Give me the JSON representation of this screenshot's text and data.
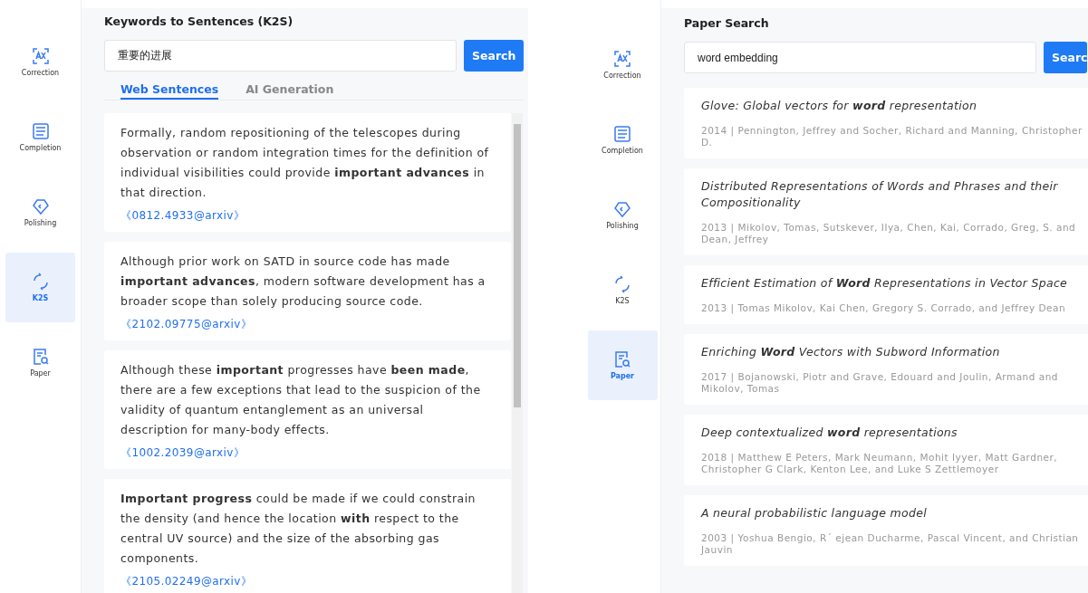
{
  "panels": [
    {
      "kind": "k2s",
      "sidebar": [
        {
          "kind": "correction",
          "label": "Correction",
          "selected": false
        },
        {
          "kind": "completion",
          "label": "Completion",
          "selected": false
        },
        {
          "kind": "polishing",
          "label": "Polishing",
          "selected": false
        },
        {
          "kind": "k2s",
          "label": "K2S",
          "selected": true
        },
        {
          "kind": "paper",
          "label": "Paper",
          "selected": false
        }
      ],
      "title": "Keywords to Sentences (K2S)",
      "search": {
        "value": "重要的进展",
        "button": "Search"
      },
      "tabs": [
        {
          "label": "Web Sentences",
          "selected": true
        },
        {
          "label": "AI Generation",
          "selected": false
        }
      ],
      "results": [
        {
          "text": "Formally, random repositioning of the telescopes during observation or random integration times for the definition of individual visibilities could provide **important advances** in that direction.",
          "source": "《0812.4933@arxiv》"
        },
        {
          "text": "Although prior work on SATD in source code has made **important advances**, modern software development has a broader scope than solely producing source code.",
          "source": "《2102.09775@arxiv》"
        },
        {
          "text": "Although these **important** progresses have **been made**, there are a few exceptions that lead to the suspicion of the validity of quantum entanglement as an universal description for many-body effects.",
          "source": "《1002.2039@arxiv》"
        },
        {
          "text": "**Important progress** could be made if we could constrain the density (and hence the location **with** respect to the central UV source) and the size of the absorbing gas components.",
          "source": "《2105.02249@arxiv》"
        }
      ]
    },
    {
      "kind": "paper",
      "sidebar": [
        {
          "kind": "correction",
          "label": "Correction",
          "selected": false
        },
        {
          "kind": "completion",
          "label": "Completion",
          "selected": false
        },
        {
          "kind": "polishing",
          "label": "Polishing",
          "selected": false
        },
        {
          "kind": "k2s",
          "label": "K2S",
          "selected": false
        },
        {
          "kind": "paper",
          "label": "Paper",
          "selected": true
        }
      ],
      "title": "Paper Search",
      "search": {
        "value": "word embedding",
        "button": "Searc"
      },
      "results": [
        {
          "title": "Glove: Global vectors for **word** representation",
          "meta": "2014 | Pennington, Jeffrey and Socher, Richard and Manning, Christopher D."
        },
        {
          "title": "Distributed Representations of Words and Phrases and their Compositionality",
          "meta": "2013 | Mikolov, Tomas, Sutskever, Ilya, Chen, Kai, Corrado, Greg, S. and Dean, Jeffrey"
        },
        {
          "title": "Efficient Estimation of **Word** Representations in Vector Space",
          "meta": "2013 | Tomas Mikolov, Kai Chen, Gregory S. Corrado, and Jeffrey Dean"
        },
        {
          "title": "Enriching **Word** Vectors with Subword Information",
          "meta": "2017 | Bojanowski, Piotr and Grave, Edouard and Joulin, Armand and Mikolov, Tomas"
        },
        {
          "title": "Deep contextualized **word** representations",
          "meta": "2018 | Matthew E Peters, Mark Neumann, Mohit Iyyer, Matt Gardner, Christopher G Clark, Kenton Lee, and Luke S Zettlemoyer"
        },
        {
          "title": "A neural probabilistic language model",
          "meta": "2003 | Yoshua Bengio, R´ ejean Ducharme, Pascal Vincent, and Christian Jauvin"
        }
      ]
    }
  ]
}
